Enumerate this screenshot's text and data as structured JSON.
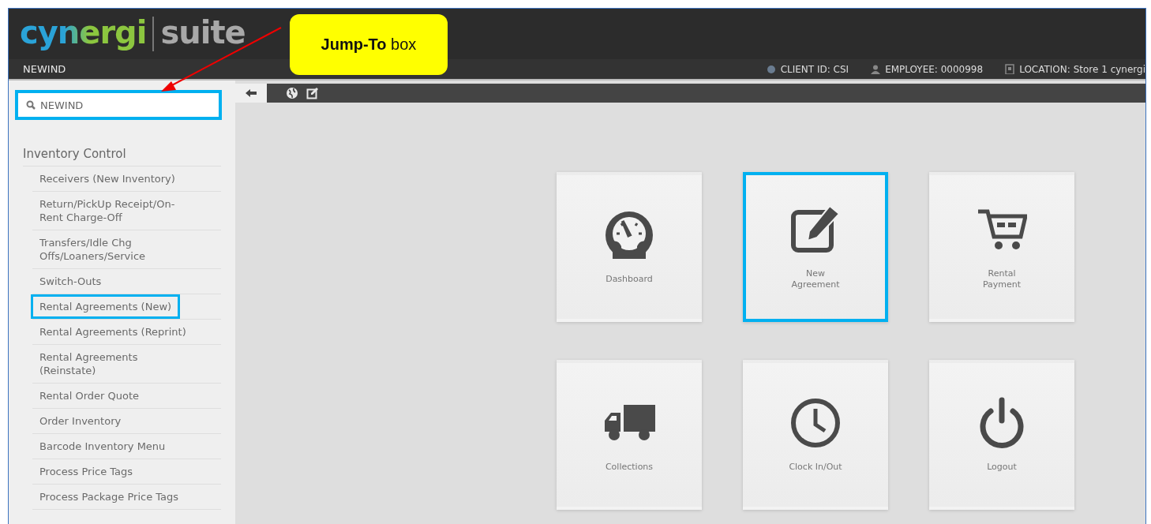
{
  "logo": {
    "part_1": "cynergi",
    "part_2": "suite"
  },
  "header": {
    "module": "NEWIND",
    "info": [
      {
        "kind": "client",
        "text": "CLIENT ID:  CSI"
      },
      {
        "kind": "employee",
        "text": "EMPLOYEE:  0000998"
      },
      {
        "kind": "location",
        "text": "LOCATION:  Store 1 cynergi"
      }
    ]
  },
  "search": {
    "value": "NEWIND",
    "highlighted": true
  },
  "sidebar": {
    "heading": "Inventory Control",
    "items": [
      {
        "label": "Receivers (New Inventory)",
        "highlighted": false
      },
      {
        "label": "Return/PickUp Receipt/On-Rent Charge-Off",
        "highlighted": false
      },
      {
        "label": "Transfers/Idle Chg Offs/Loaners/Service",
        "highlighted": false
      },
      {
        "label": "Switch-Outs",
        "highlighted": false
      },
      {
        "label": "Rental Agreements (New)",
        "highlighted": true
      },
      {
        "label": "Rental Agreements (Reprint)",
        "highlighted": false
      },
      {
        "label": "Rental Agreements (Reinstate)",
        "highlighted": false
      },
      {
        "label": "Rental Order Quote",
        "highlighted": false
      },
      {
        "label": "Order Inventory",
        "highlighted": false
      },
      {
        "label": "Barcode Inventory Menu",
        "highlighted": false
      },
      {
        "label": "Process Price Tags",
        "highlighted": false
      },
      {
        "label": "Process Package Price Tags",
        "highlighted": false
      }
    ]
  },
  "tiles": [
    {
      "kind": "gauge",
      "label": "Dashboard",
      "highlighted": false
    },
    {
      "kind": "edit",
      "label": "New Agreement",
      "highlighted": true
    },
    {
      "kind": "cart",
      "label": "Rental Payment",
      "highlighted": false
    },
    {
      "kind": "truck",
      "label": "Collections",
      "highlighted": false
    },
    {
      "kind": "clock",
      "label": "Clock In/Out",
      "highlighted": false
    },
    {
      "kind": "power",
      "label": "Logout",
      "highlighted": false
    }
  ],
  "callout": {
    "text": "**Jump-To** box"
  }
}
